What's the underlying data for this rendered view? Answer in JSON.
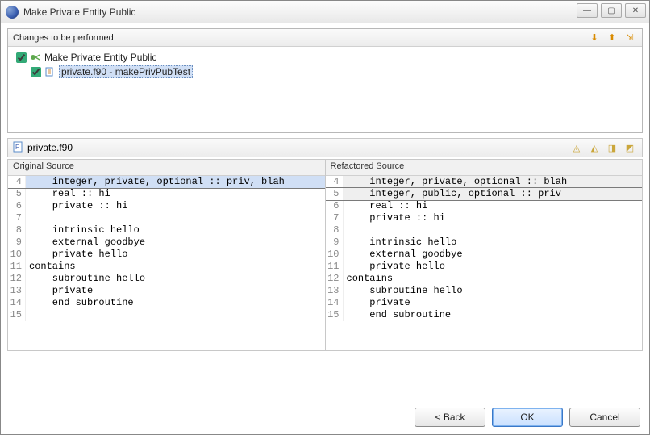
{
  "window": {
    "title": "Make Private Entity Public"
  },
  "changes": {
    "header": "Changes to be performed",
    "items": [
      {
        "label": "Make Private Entity Public",
        "checked": true
      },
      {
        "label": "private.f90 - makePrivPubTest",
        "checked": true
      }
    ]
  },
  "filebar": {
    "filename": "private.f90"
  },
  "diff": {
    "left_header": "Original Source",
    "right_header": "Refactored Source",
    "left": [
      {
        "n": 4,
        "text": "    integer, private, optional :: priv, blah",
        "cls": "hl-blue hl-box"
      },
      {
        "n": 5,
        "text": "    real :: hi",
        "cls": ""
      },
      {
        "n": 6,
        "text": "    private :: hi",
        "cls": ""
      },
      {
        "n": 7,
        "text": "",
        "cls": ""
      },
      {
        "n": 8,
        "text": "    intrinsic hello",
        "cls": ""
      },
      {
        "n": 9,
        "text": "    external goodbye",
        "cls": ""
      },
      {
        "n": 10,
        "text": "    private hello",
        "cls": ""
      },
      {
        "n": 11,
        "text": "contains",
        "cls": ""
      },
      {
        "n": 12,
        "text": "    subroutine hello",
        "cls": ""
      },
      {
        "n": 13,
        "text": "    private",
        "cls": ""
      },
      {
        "n": 14,
        "text": "    end subroutine",
        "cls": ""
      },
      {
        "n": 15,
        "text": "",
        "cls": ""
      }
    ],
    "right": [
      {
        "n": 4,
        "text": "    integer, private, optional :: blah",
        "cls": "hl-del"
      },
      {
        "n": 5,
        "text": "    integer, public, optional :: priv",
        "cls": "hl-del hl-box"
      },
      {
        "n": 6,
        "text": "    real :: hi",
        "cls": ""
      },
      {
        "n": 7,
        "text": "    private :: hi",
        "cls": ""
      },
      {
        "n": 8,
        "text": "",
        "cls": ""
      },
      {
        "n": 9,
        "text": "    intrinsic hello",
        "cls": ""
      },
      {
        "n": 10,
        "text": "    external goodbye",
        "cls": ""
      },
      {
        "n": 11,
        "text": "    private hello",
        "cls": ""
      },
      {
        "n": 12,
        "text": "contains",
        "cls": ""
      },
      {
        "n": 13,
        "text": "    subroutine hello",
        "cls": ""
      },
      {
        "n": 14,
        "text": "    private",
        "cls": ""
      },
      {
        "n": 15,
        "text": "    end subroutine",
        "cls": ""
      }
    ]
  },
  "buttons": {
    "back": "< Back",
    "ok": "OK",
    "cancel": "Cancel"
  },
  "icons": {
    "arrow_down": "⬇",
    "arrow_up": "⬆",
    "filter": "⇲",
    "nav1": "◬",
    "nav2": "◭",
    "nav3": "◨",
    "nav4": "◩"
  }
}
